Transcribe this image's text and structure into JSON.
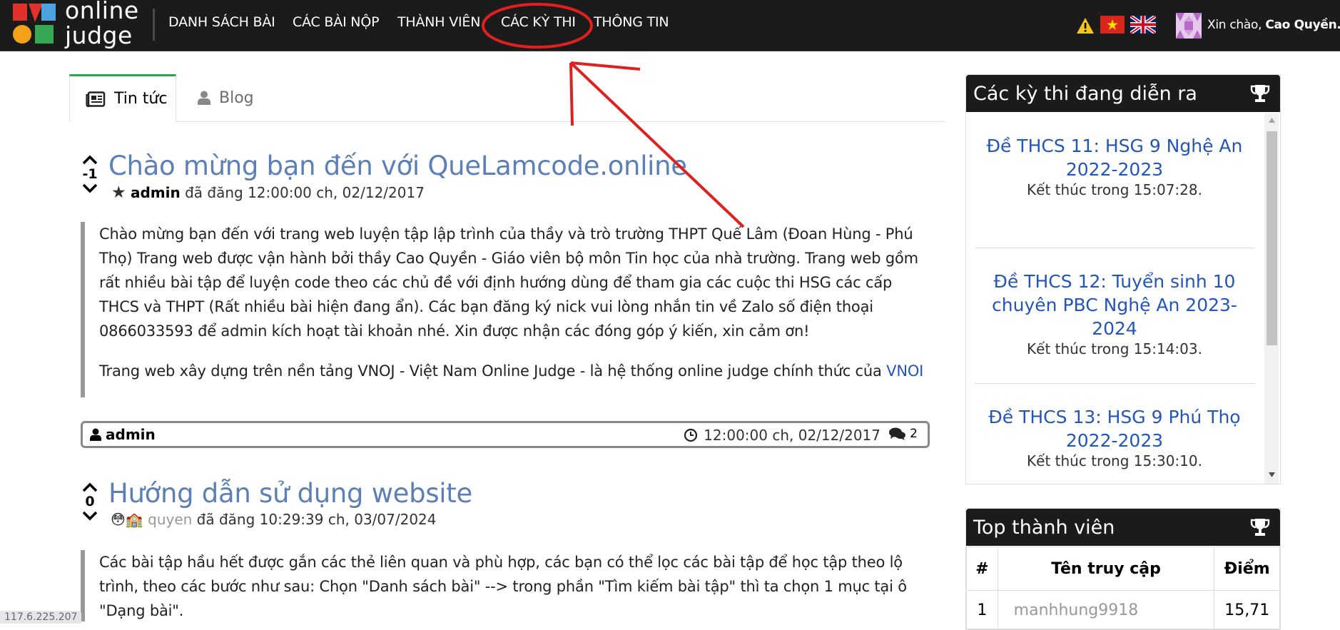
{
  "navbar": {
    "brand_line1": "online",
    "brand_line2": "judge",
    "items": [
      {
        "label": "DANH SÁCH BÀI"
      },
      {
        "label": "CÁC BÀI NỘP"
      },
      {
        "label": "THÀNH VIÊN"
      },
      {
        "label": "CÁC KỲ THI"
      },
      {
        "label": "THÔNG TIN"
      }
    ],
    "greeting": "Xin chào,",
    "username": "Cao Quyền.",
    "icons": [
      "warning-icon",
      "vietnam-flag-icon",
      "uk-flag-icon",
      "user-avatar"
    ]
  },
  "tabs": [
    {
      "label": "Tin tức",
      "icon": "newspaper-icon",
      "active": true
    },
    {
      "label": "Blog",
      "icon": "user-icon",
      "active": false
    }
  ],
  "posts": [
    {
      "score": "-1",
      "title": "Chào mừng bạn đến với QueLamcode.online",
      "author": "admin",
      "posted_text": "đã đăng 12:00:00 ch, 02/12/2017",
      "paragraphs": [
        "Chào mừng bạn đến với trang web luyện tập lập trình của thầy và trò trường THPT Quế Lâm (Đoan Hùng - Phú Thọ) Trang web được vận hành bởi thầy Cao Quyền - Giáo viên bộ môn Tin học của nhà trường. Trang web gồm rất nhiều bài tập để luyện code theo các chủ đề với định hướng dùng để tham gia các cuộc thi HSG các cấp THCS và THPT (Rất nhiều bài hiện đang ẩn). Các bạn đăng ký nick vui lòng nhắn tin về Zalo số điện thoại 0866033593 để admin kích hoạt tài khoản nhé. Xin được nhận các đóng góp ý kiến, xin cảm ơn!",
        "Trang web xây dựng trên nền tảng VNOJ - Việt Nam Online Judge - là hệ thống online judge chính thức của "
      ],
      "link_text": "VNOI",
      "footer_author": "admin",
      "footer_time": "12:00:00 ch, 02/12/2017",
      "comment_count": "2"
    },
    {
      "score": "0",
      "title": "Hướng dẫn sử dụng website",
      "author": "quyen",
      "posted_text": "đã đăng 10:29:39 ch, 03/07/2024",
      "paragraphs": [
        "Các bài tập hầu hết được gắn các thẻ liên quan và phù hợp, các bạn có thể lọc các bài tập để học tập theo lộ trình, theo các bước như sau: Chọn \"Danh sách bài\" --> trong phần \"Tìm kiếm bài tập\" thì ta chọn 1 mục tại ô \"Dạng bài\"."
      ]
    }
  ],
  "sidebar": {
    "contests_title": "Các kỳ thi đang diễn ra",
    "contests": [
      {
        "name": "Đề THCS 11: HSG 9 Nghệ An 2022-2023",
        "time": "Kết thúc trong 15:07:28."
      },
      {
        "name": "Đề THCS 12: Tuyển sinh 10 chuyên PBC Nghệ An 2023-2024",
        "time": "Kết thúc trong 15:14:03."
      },
      {
        "name": "Đề THCS 13: HSG 9 Phú Thọ 2022-2023",
        "time": "Kết thúc trong 15:30:10."
      }
    ],
    "top_title": "Top thành viên",
    "top_columns": [
      "#",
      "Tên truy cập",
      "Điểm"
    ],
    "top_rows": [
      {
        "rank": "1",
        "user": "manhhung9918",
        "points": "15,71"
      }
    ]
  },
  "ip_text": "117.6.225.207",
  "colors": {
    "navbar_bg": "#1b1b1b",
    "title_blue": "#5c7fb6",
    "link_blue": "#2356b8",
    "tab_active_border": "#2ca64d",
    "annotation_red": "#e0201f"
  }
}
